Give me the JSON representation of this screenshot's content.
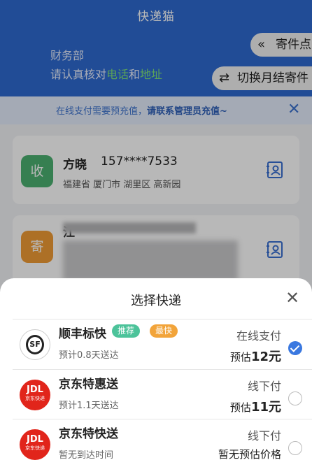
{
  "header": {
    "title": "快递猫",
    "department": "财务部",
    "verify_prefix": "请认真核对",
    "verify_phone": "电话",
    "verify_and": "和",
    "verify_address": "地址",
    "outlets_label": "寄件点",
    "switch_label": "切换月结寄件"
  },
  "notice": {
    "text_plain": "在线支付需要预充值，",
    "text_bold": "请联系管理员充值~"
  },
  "recipient": {
    "badge": "收",
    "name": "方晓",
    "phone": "157****7533",
    "address": "福建省 厦门市 湖里区 高新园"
  },
  "sender": {
    "badge": "寄",
    "name_visible": "江"
  },
  "sheet": {
    "title": "选择快递",
    "options": [
      {
        "carrier": "顺丰标快",
        "tags": [
          "推荐",
          "最快"
        ],
        "sub": "预计0.8天送达",
        "payment": "在线支付",
        "price_prefix": "预估",
        "price_value": "12元",
        "selected": true
      },
      {
        "carrier": "京东特惠送",
        "sub": "预计1.1天送达",
        "payment": "线下付",
        "price_prefix": "预估",
        "price_value": "11元",
        "selected": false
      },
      {
        "carrier": "京东特快送",
        "sub": "暂无到达时间",
        "payment": "线下付",
        "price_text": "暂无预估价格",
        "selected": false
      }
    ]
  },
  "logos": {
    "sf": "SF",
    "jd_main": "JDL",
    "jd_sub": "京东快递"
  },
  "colors": {
    "header_bg": "#2f6ad0",
    "highlight_green": "#7ee27a",
    "notice_blue": "#3e73cf",
    "recv_badge": "#4cb071",
    "send_badge": "#f09c35",
    "tag_recommend": "#4cc39a",
    "tag_fastest": "#f2a43a",
    "selected_blue": "#3a78e0",
    "jd_red": "#e1251b"
  }
}
